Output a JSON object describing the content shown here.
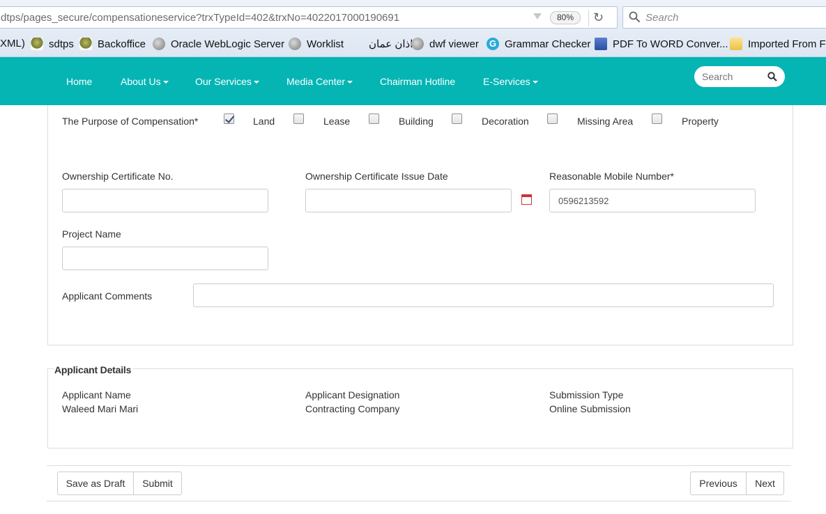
{
  "browser": {
    "url": "dtps/pages_secure/compensationeservice?trxTypeId=402&trxNo=4022017000190691",
    "zoom": "80%",
    "search_placeholder": "Search",
    "bookmarks": [
      {
        "label": "XML)",
        "icon": "none"
      },
      {
        "label": "sdtps",
        "icon": "sdtps-icon"
      },
      {
        "label": "Backoffice",
        "icon": "sdtps-icon"
      },
      {
        "label": "Oracle WebLogic Server",
        "icon": "globe-icon"
      },
      {
        "label": "Worklist",
        "icon": "globe-icon"
      },
      {
        "label": "اذان عمان",
        "icon": "none"
      },
      {
        "label": "dwf viewer",
        "icon": "globe-icon"
      },
      {
        "label": "Grammar Checker",
        "icon": "grammar-icon"
      },
      {
        "label": "PDF To WORD Conver...",
        "icon": "pdf-icon"
      },
      {
        "label": "Imported From F",
        "icon": "folder-icon"
      }
    ]
  },
  "nav": {
    "items": [
      {
        "label": "Home",
        "dropdown": false
      },
      {
        "label": "About Us",
        "dropdown": true
      },
      {
        "label": "Our Services",
        "dropdown": true
      },
      {
        "label": "Media Center",
        "dropdown": true
      },
      {
        "label": "Chairman Hotline",
        "dropdown": false
      },
      {
        "label": "E-Services",
        "dropdown": true
      }
    ],
    "search_placeholder": "Search"
  },
  "form": {
    "purpose_label": "The Purpose of Compensation*",
    "purpose_options": [
      {
        "label": "Land",
        "checked": true
      },
      {
        "label": "Lease",
        "checked": false
      },
      {
        "label": "Building",
        "checked": false
      },
      {
        "label": "Decoration",
        "checked": false
      },
      {
        "label": "Missing Area",
        "checked": false
      },
      {
        "label": "Property",
        "checked": false
      }
    ],
    "ownership_cert_no_label": "Ownership Certificate No.",
    "ownership_cert_no_value": "",
    "ownership_cert_date_label": "Ownership Certificate Issue Date",
    "ownership_cert_date_value": "",
    "mobile_label": "Reasonable Mobile Number*",
    "mobile_value": "0596213592",
    "project_name_label": "Project Name",
    "project_name_value": "",
    "comments_label": "Applicant Comments",
    "comments_value": ""
  },
  "applicant": {
    "legend": "Applicant Details",
    "name_label": "Applicant Name",
    "name_value": "Waleed Mari Mari",
    "designation_label": "Applicant Designation",
    "designation_value": "Contracting Company",
    "submission_type_label": "Submission Type",
    "submission_type_value": "Online Submission"
  },
  "actions": {
    "save_draft": "Save as Draft",
    "submit": "Submit",
    "previous": "Previous",
    "next": "Next"
  }
}
